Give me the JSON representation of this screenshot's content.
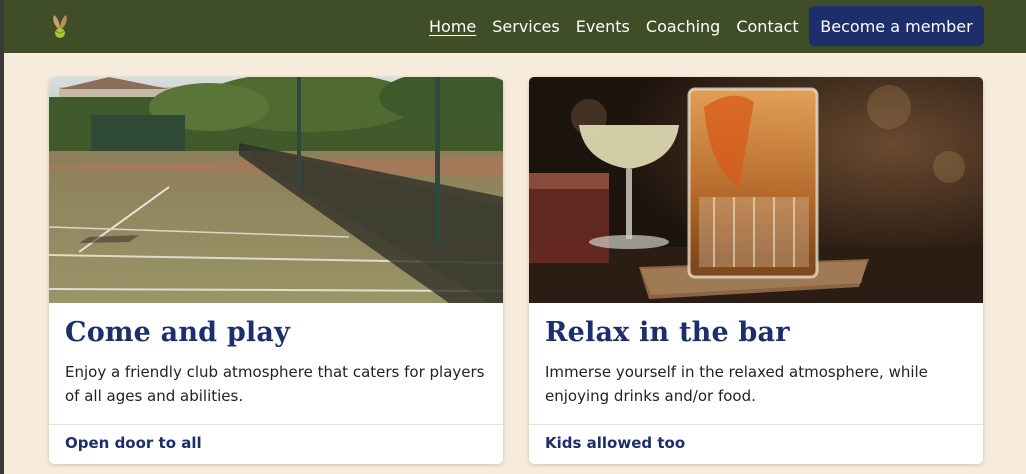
{
  "nav": {
    "logo_icon": "tennis-sprout-logo-icon",
    "links": [
      {
        "label": "Home",
        "active": true
      },
      {
        "label": "Services"
      },
      {
        "label": "Events"
      },
      {
        "label": "Coaching"
      },
      {
        "label": "Contact"
      }
    ],
    "cta_label": "Become a member"
  },
  "cards": [
    {
      "title": "Come and play",
      "text": "Enjoy a friendly club atmosphere that caters for players of all ages and abilities.",
      "footer": "Open door to all"
    },
    {
      "title": "Relax in the bar",
      "text": "Immerse yourself in the relaxed atmosphere, while enjoying drinks and/or food.",
      "footer": "Kids allowed too"
    }
  ],
  "colors": {
    "nav_bg": "#3f4e26",
    "page_bg": "#f7ecdc",
    "brand_blue": "#1c2f6b"
  }
}
